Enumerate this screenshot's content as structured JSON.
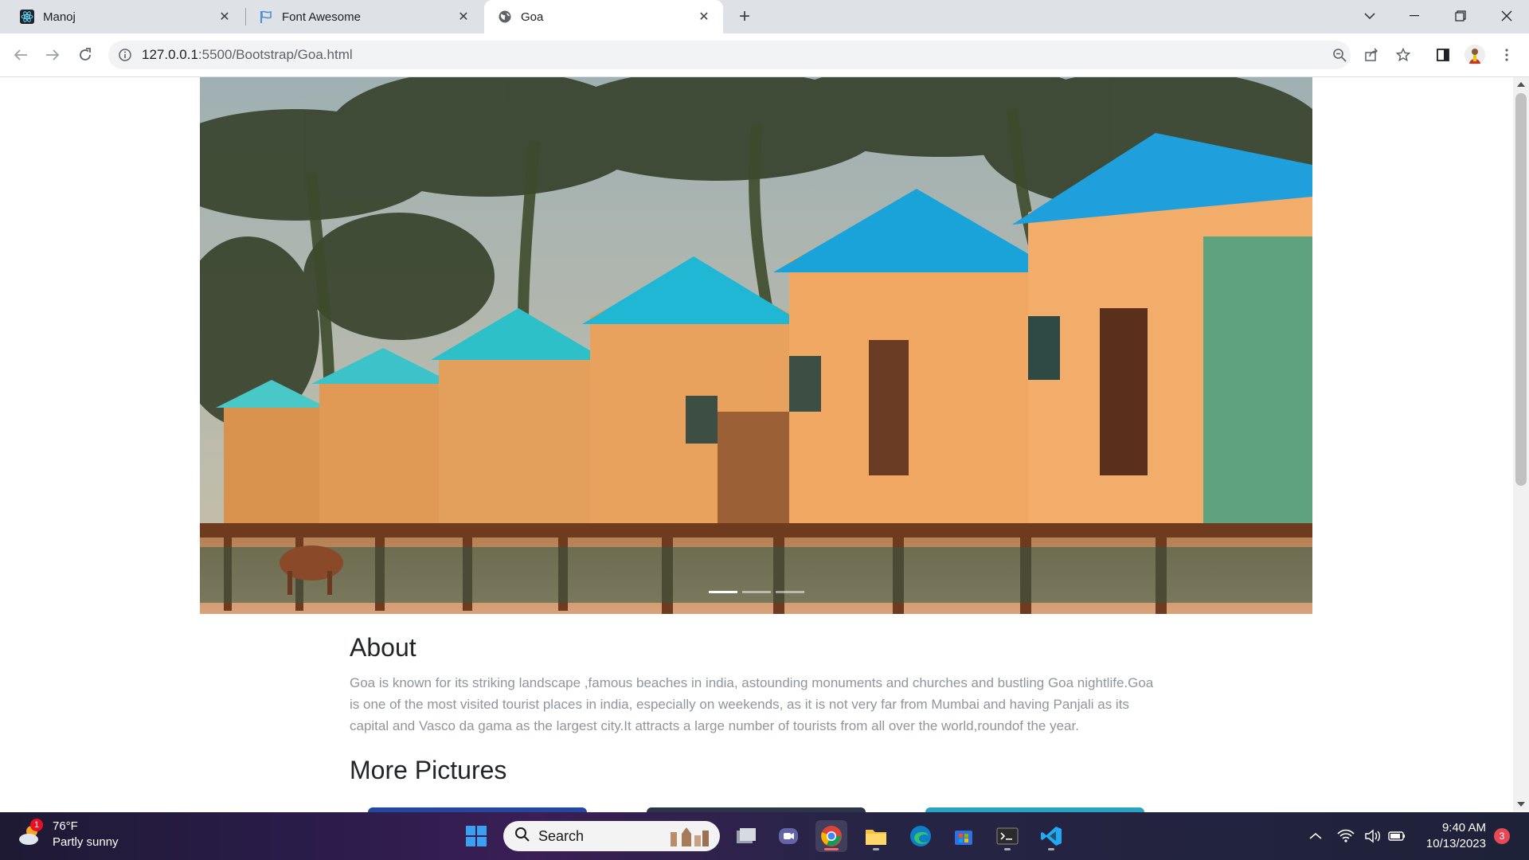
{
  "browser": {
    "tabs": [
      {
        "title": "Manoj",
        "icon": "react-icon"
      },
      {
        "title": "Font Awesome",
        "icon": "flag-icon"
      },
      {
        "title": "Goa",
        "icon": "globe-icon",
        "active": true
      }
    ],
    "url": {
      "host": "127.0.0.1",
      "rest": ":5500/Bootstrap/Goa.html"
    }
  },
  "page": {
    "hero_image": "beach-huts-image",
    "about": {
      "heading": "About",
      "text": "Goa is known for its striking landscape ,famous beaches in india, astounding monuments and churches and bustling Goa nightlife.Goa is one of the most visited tourist places in india, especially on weekends, as it is not very far from Mumbai and having Panjali as its capital and Vasco da gama as the largest city.It attracts a large number of tourists from all over the world,roundof the year."
    },
    "more_heading": "More Pictures",
    "carousel_count": 3
  },
  "taskbar": {
    "weather": {
      "temp": "76°F",
      "condition": "Partly sunny",
      "badge": "1"
    },
    "search_label": "Search",
    "clock": {
      "time": "9:40 AM",
      "date": "10/13/2023"
    },
    "notification_count": "3"
  },
  "colors": {
    "accent": "#1a73e8",
    "tab_strip": "#dee1e6",
    "hut_roof": "#1aa3d9"
  }
}
